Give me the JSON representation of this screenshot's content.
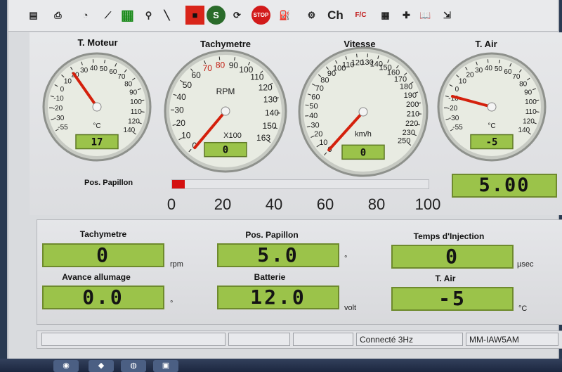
{
  "toolbar": {
    "items": [
      {
        "name": "save-icon",
        "glyph": "▤"
      },
      {
        "name": "print-icon",
        "glyph": "⎙"
      },
      {
        "name": "dashboard-icon",
        "glyph": "◔"
      },
      {
        "name": "graph-icon",
        "glyph": "⟋"
      },
      {
        "name": "grid-icon",
        "glyph": "▦"
      },
      {
        "name": "probe-icon",
        "glyph": "⚲"
      },
      {
        "name": "wand-icon",
        "glyph": "╲"
      },
      {
        "name": "ecu-icon",
        "glyph": "■"
      },
      {
        "name": "s-icon",
        "glyph": "S"
      },
      {
        "name": "refresh-icon",
        "glyph": "⟳"
      },
      {
        "name": "stop-icon",
        "glyph": "STOP"
      },
      {
        "name": "fuel-icon",
        "glyph": "⛽"
      },
      {
        "name": "motorbike-icon",
        "glyph": "⚙"
      },
      {
        "name": "ch-icon",
        "glyph": "Ch"
      },
      {
        "name": "fahrenheit-celsius-icon",
        "glyph": "F/C"
      },
      {
        "name": "calculator-icon",
        "glyph": "▦"
      },
      {
        "name": "tools-icon",
        "glyph": "✚"
      },
      {
        "name": "book-icon",
        "glyph": "📖"
      },
      {
        "name": "exit-icon",
        "glyph": "⇲"
      }
    ]
  },
  "gauges": {
    "moteur": {
      "title": "T. Moteur",
      "unit": "°C",
      "value": "17",
      "ticks": [
        "-55",
        "-30",
        "-20",
        "-10",
        "0",
        "10",
        "20",
        "30",
        "40",
        "50",
        "60",
        "70",
        "80",
        "90",
        "100",
        "110",
        "120",
        "140"
      ]
    },
    "tachy": {
      "title": "Tachymetre",
      "unit": "RPM",
      "multiplier": "X100",
      "value": "0",
      "ticks": [
        "0",
        "10",
        "20",
        "30",
        "40",
        "50",
        "60",
        "70",
        "80",
        "90",
        "100",
        "110",
        "120",
        "130",
        "140",
        "150",
        "163"
      ]
    },
    "vitesse": {
      "title": "Vitesse",
      "unit": "km/h",
      "value": "0",
      "ticks": [
        "0",
        "10",
        "20",
        "30",
        "40",
        "50",
        "60",
        "70",
        "80",
        "90",
        "100",
        "110",
        "120",
        "130",
        "140",
        "150",
        "160",
        "170",
        "180",
        "190",
        "200",
        "210",
        "220",
        "230",
        "250"
      ]
    },
    "air": {
      "title": "T. Air",
      "unit": "°C",
      "value": "-5",
      "ticks": [
        "-55",
        "-30",
        "-20",
        "-10",
        "0",
        "10",
        "20",
        "30",
        "40",
        "50",
        "60",
        "70",
        "80",
        "90",
        "100",
        "110",
        "120",
        "140"
      ]
    }
  },
  "papillon": {
    "label": "Pos. Papillon",
    "fraction": 0.05,
    "scale": [
      "0",
      "20",
      "40",
      "60",
      "80",
      "100"
    ],
    "display": "5.00"
  },
  "fields": {
    "tachy": {
      "label": "Tachymetre",
      "value": "0",
      "unit": "rpm"
    },
    "papillon": {
      "label": "Pos. Papillon",
      "value": "5.0",
      "unit": "°"
    },
    "injection": {
      "label": "Temps d'Injection",
      "value": "0",
      "unit": "µsec"
    },
    "avance": {
      "label": "Avance allumage",
      "value": "0.0",
      "unit": "°"
    },
    "batterie": {
      "label": "Batterie",
      "value": "12.0",
      "unit": "volt"
    },
    "air": {
      "label": "T. Air",
      "value": "-5",
      "unit": "°C"
    }
  },
  "status": {
    "connection": "Connecté 3Hz",
    "ecu": "MM-IAW5AM"
  },
  "colors": {
    "display_green": "#9bc34a",
    "needle_red": "#d4200c",
    "bar_red": "#d41010"
  }
}
